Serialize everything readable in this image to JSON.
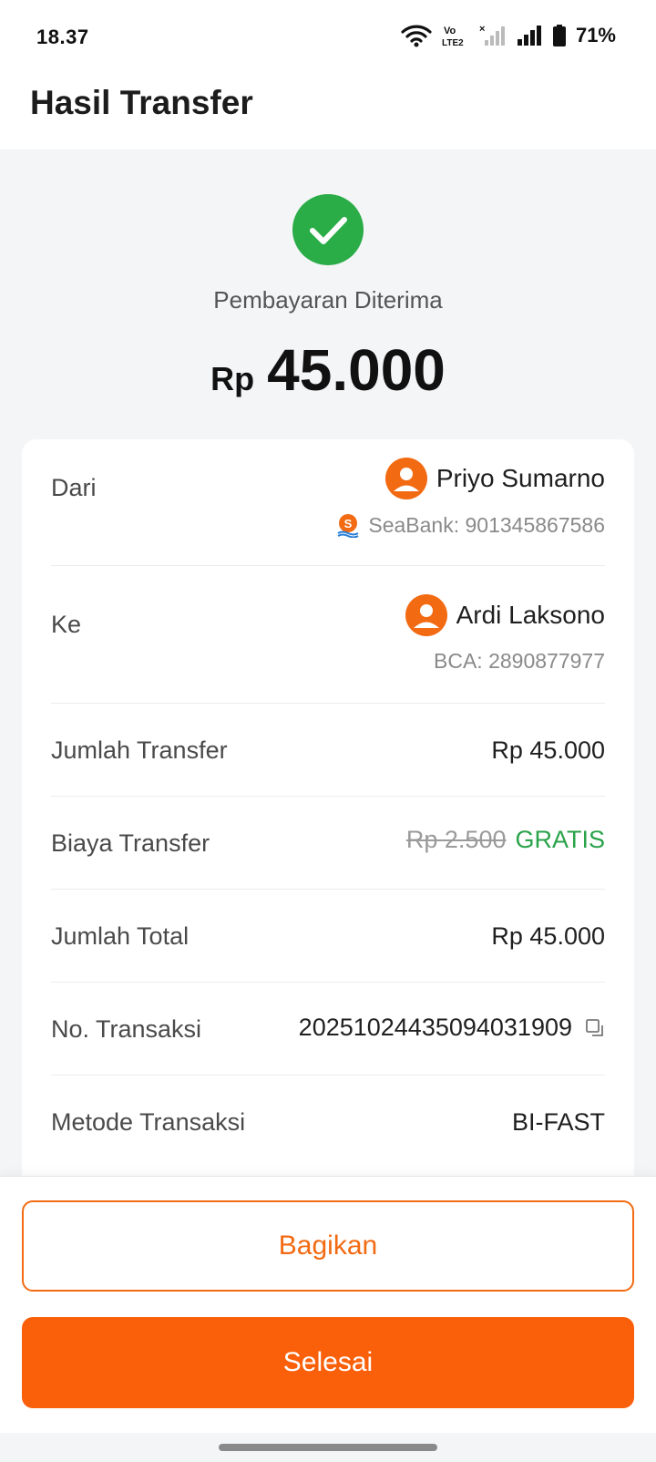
{
  "status_bar": {
    "time": "18.37",
    "battery_percent": "71%",
    "icons": [
      "wifi-icon",
      "volte-icon",
      "signal-sim2-icon",
      "signal-sim1-icon",
      "battery-icon"
    ]
  },
  "app_bar": {
    "title": "Hasil Transfer"
  },
  "result": {
    "status_text": "Pembayaran Diterima",
    "currency": "Rp",
    "amount": "45.000",
    "icon": "check-circle-icon",
    "accent_color": "#2aac47"
  },
  "details": {
    "from": {
      "label": "Dari",
      "name": "Priyo Sumarno",
      "bank": "SeaBank: 901345867586",
      "avatar_icon": "user-avatar-icon",
      "bank_icon": "seabank-logo-icon"
    },
    "to": {
      "label": "Ke",
      "name": "Ardi Laksono",
      "bank": "BCA: 2890877977",
      "avatar_icon": "user-avatar-icon"
    },
    "transfer_amount": {
      "label": "Jumlah Transfer",
      "value": "Rp 45.000"
    },
    "transfer_fee": {
      "label": "Biaya Transfer",
      "original": "Rp 2.500",
      "value": "GRATIS"
    },
    "total": {
      "label": "Jumlah Total",
      "value": "Rp 45.000"
    },
    "transaction_no": {
      "label": "No. Transaksi",
      "value": "20251024435094031909",
      "icon": "copy-icon"
    },
    "method": {
      "label": "Metode Transaksi",
      "value": "BI-FAST"
    }
  },
  "actions": {
    "share_label": "Bagikan",
    "done_label": "Selesai",
    "brand_color": "#fa5f0a"
  }
}
